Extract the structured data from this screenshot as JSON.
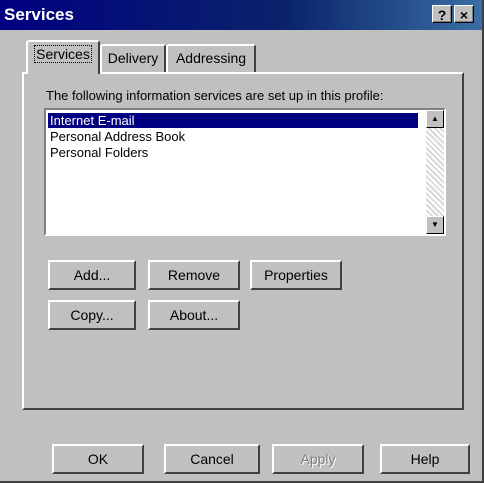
{
  "window": {
    "title": "Services"
  },
  "titlebar": {
    "help_label": "?",
    "close_label": "×"
  },
  "tabs": [
    {
      "label": "Services",
      "active": true
    },
    {
      "label": "Delivery",
      "active": false
    },
    {
      "label": "Addressing",
      "active": false
    }
  ],
  "services": {
    "caption": "The following information services are set up in this profile:",
    "items": [
      {
        "label": "Internet E-mail",
        "selected": true
      },
      {
        "label": "Personal Address Book",
        "selected": false
      },
      {
        "label": "Personal Folders",
        "selected": false
      }
    ]
  },
  "actions": {
    "add": "Add...",
    "remove": "Remove",
    "properties": "Properties",
    "copy": "Copy...",
    "about": "About..."
  },
  "footer": {
    "ok": "OK",
    "cancel": "Cancel",
    "apply": "Apply",
    "help": "Help"
  },
  "colors": {
    "face": "#c0c0c0",
    "titlebar": "#000080",
    "selection": "#000080"
  }
}
